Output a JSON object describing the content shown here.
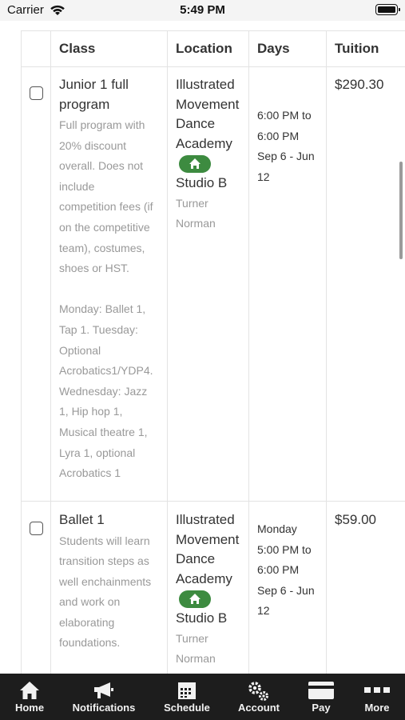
{
  "status_bar": {
    "carrier": "Carrier",
    "time": "5:49 PM"
  },
  "table": {
    "headers": {
      "class": "Class",
      "location": "Location",
      "days": "Days",
      "tuition": "Tuition"
    },
    "rows": [
      {
        "checked": false,
        "class_name": "Junior 1 full program",
        "description_lines": [
          "Full program with",
          "20% discount",
          "overall. Does not",
          "include",
          "competition fees (if",
          "on the competitive",
          "team), costumes,",
          "shoes or HST.",
          "",
          "Monday: Ballet 1,",
          "Tap 1. Tuesday:",
          "Optional",
          "Acrobatics1/YDP4.",
          "Wednesday: Jazz",
          "1, Hip hop 1,",
          "Musical theatre 1,",
          "Lyra 1, optional",
          "Acrobatics 1"
        ],
        "location_lines": [
          "Illustrated",
          "Movement",
          "Dance",
          "Academy"
        ],
        "room": "Studio B",
        "instructor_lines": [
          "Turner",
          "Norman"
        ],
        "days_lines": [
          "6:00 PM to",
          "6:00 PM",
          "Sep 6 - Jun",
          "12"
        ],
        "tuition": "$290.30"
      },
      {
        "checked": false,
        "class_name": "Ballet 1",
        "description_lines": [
          "Students will learn",
          "transition steps as",
          "well enchainments",
          "and work on",
          "elaborating",
          "foundations."
        ],
        "location_lines": [
          "Illustrated",
          "Movement",
          "Dance",
          "Academy"
        ],
        "room": "Studio B",
        "instructor_lines": [
          "Turner",
          "Norman"
        ],
        "days_lines": [
          "Monday",
          "5:00 PM to",
          "6:00 PM",
          "Sep 6 - Jun",
          "12"
        ],
        "tuition": "$59.00"
      }
    ]
  },
  "tabbar": {
    "home": "Home",
    "notifications": "Notifications",
    "schedule": "Schedule",
    "account": "Account",
    "pay": "Pay",
    "more": "More"
  },
  "colors": {
    "location_badge": "#3d8b40",
    "tabbar_bg": "#1d1d1d"
  },
  "icons": [
    "wifi-icon",
    "battery-icon",
    "checkbox",
    "home-icon",
    "megaphone-icon",
    "calendar-icon",
    "gears-icon",
    "credit-card-icon",
    "more-icon"
  ]
}
